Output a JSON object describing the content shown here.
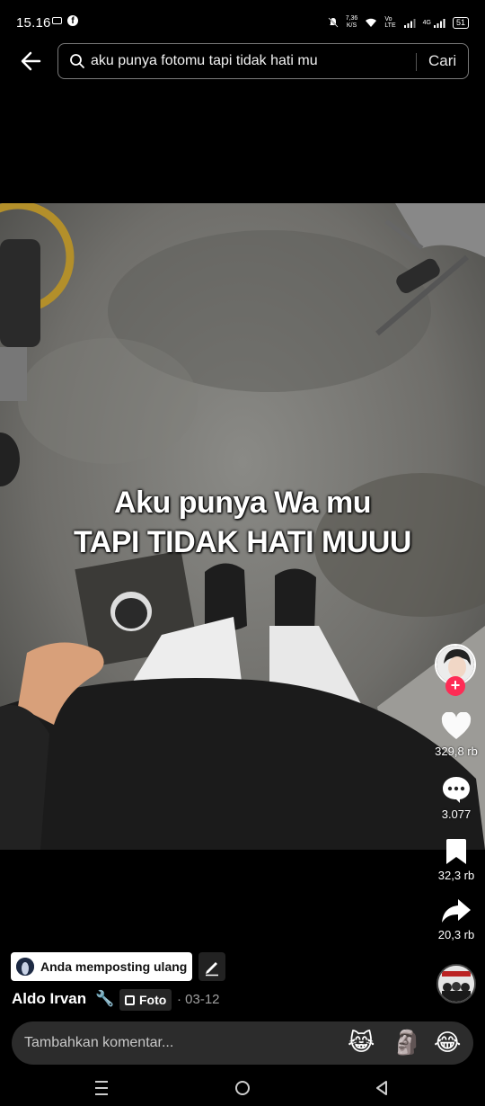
{
  "status_bar": {
    "time": "15.16",
    "speed_value": "7,36",
    "speed_unit": "K/S",
    "net_label_top": "Vo",
    "net_label_bottom": "LTE",
    "net_gen": "4G",
    "battery": "51"
  },
  "search": {
    "query": "aku punya fotomu tapi tidak hati mu",
    "action_label": "Cari"
  },
  "post": {
    "caption_line1": "Aku punya Wa mu",
    "caption_line2": "TAPI TIDAK HATI MUUU",
    "repost_label": "Anda memposting ulang",
    "author": "Aldo Irvan",
    "author_emoji": "🔧",
    "type_badge": "Foto",
    "date": "· 03-12"
  },
  "actions": {
    "likes": "329,8 rb",
    "comments": "3.077",
    "saves": "32,3 rb",
    "shares": "20,3 rb"
  },
  "comment_bar": {
    "placeholder": "Tambahkan komentar...",
    "emojis": [
      "😹",
      "🗿",
      "😂"
    ]
  },
  "colors": {
    "accent": "#fe2c55",
    "background": "#000000"
  }
}
